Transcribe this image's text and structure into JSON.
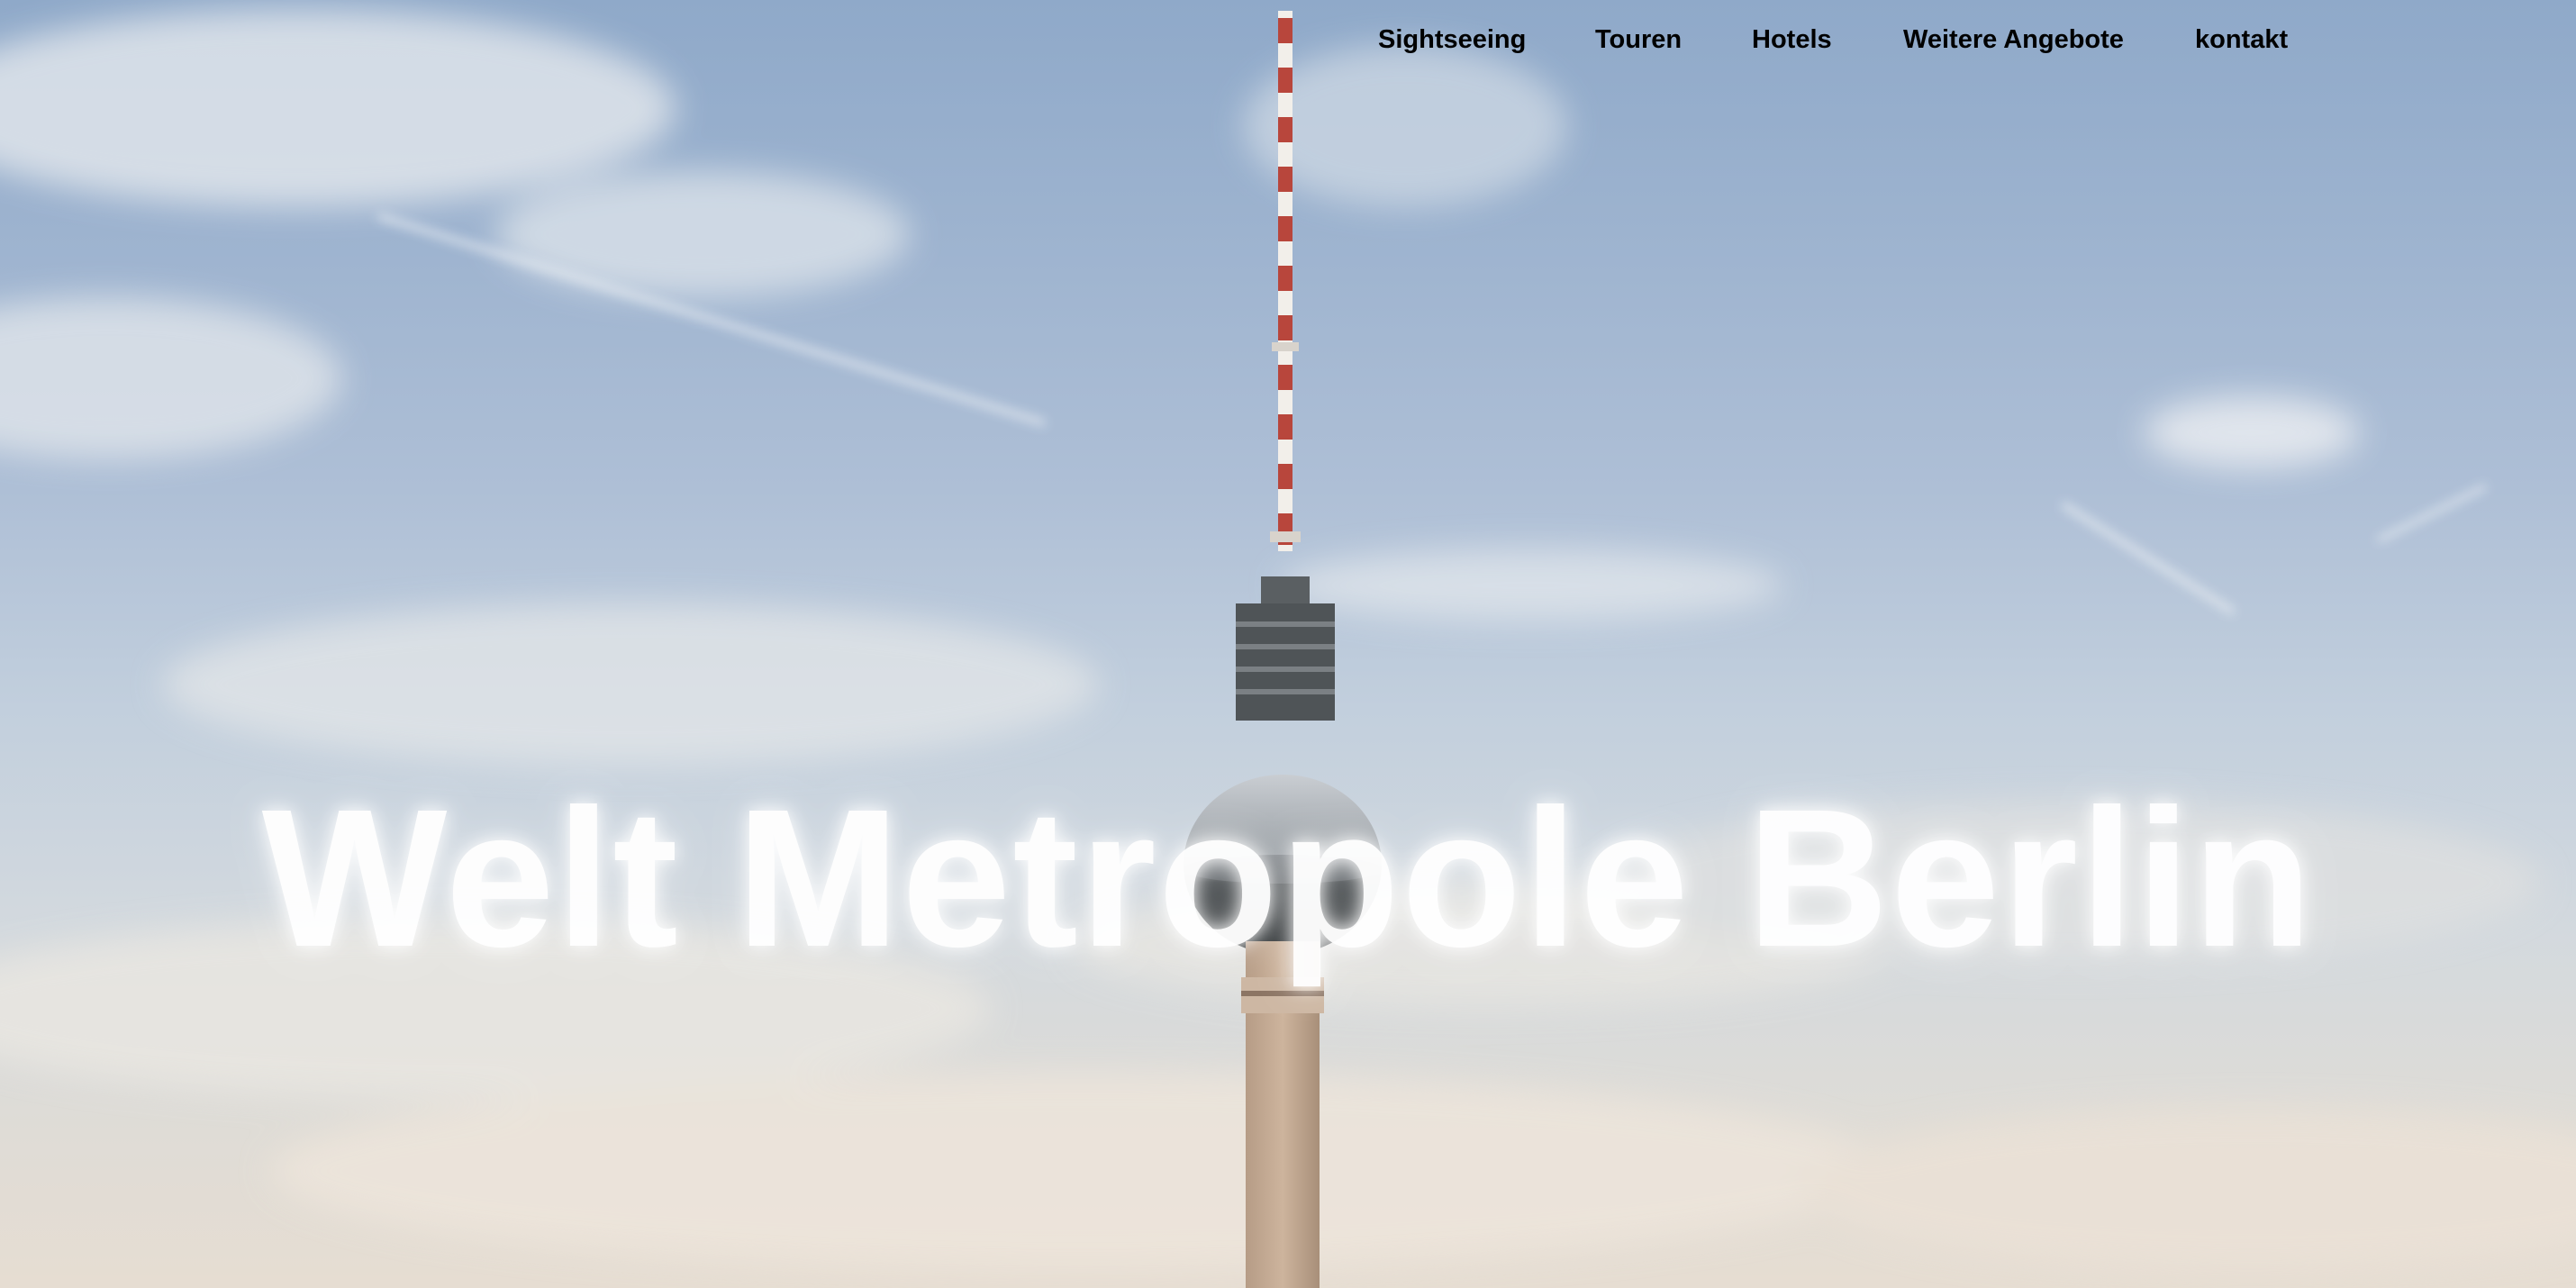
{
  "nav": {
    "items": [
      {
        "label": "Sightseeing"
      },
      {
        "label": "Touren"
      },
      {
        "label": "Hotels"
      },
      {
        "label": "Weitere Angebote"
      },
      {
        "label": "kontakt"
      }
    ]
  },
  "hero": {
    "headline": "Welt Metropole Berlin",
    "image": "berlin-tv-tower-sky"
  },
  "colors": {
    "nav_text": "#000000",
    "headline": "#ffffff",
    "sky_top": "#8fa9c9",
    "sky_bottom": "#e6ddd2"
  }
}
